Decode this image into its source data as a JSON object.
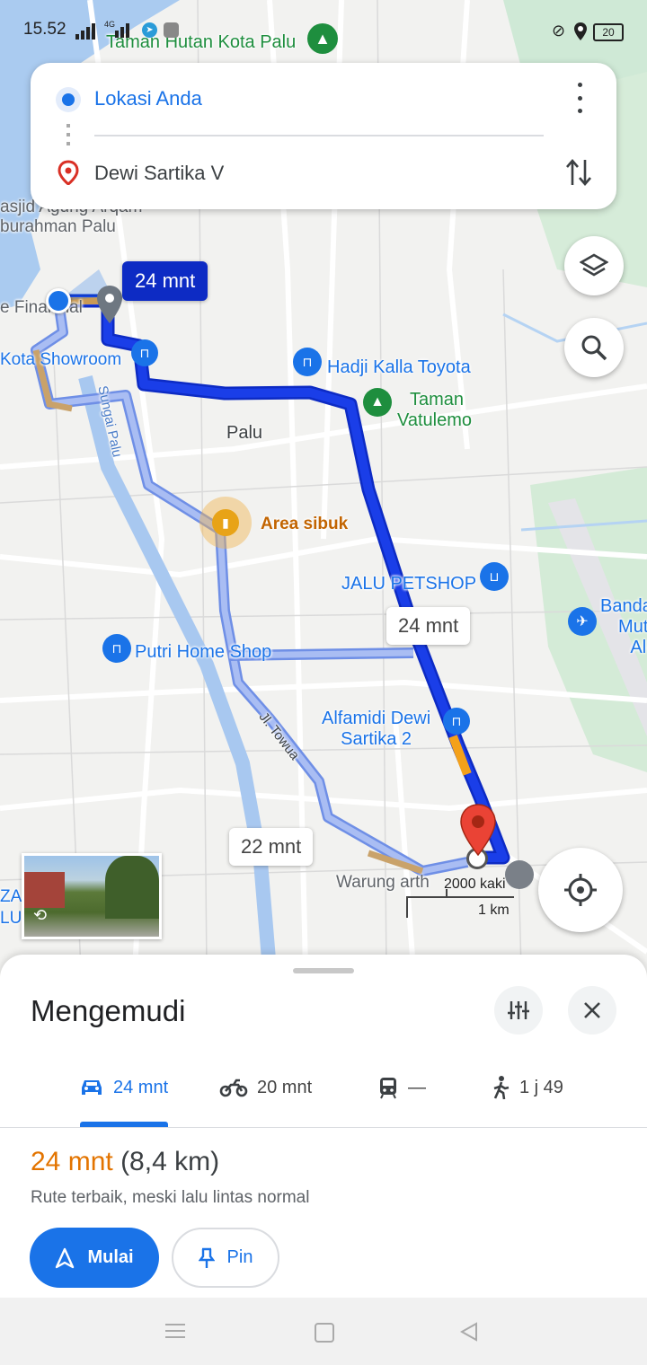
{
  "status_bar": {
    "time": "15.52",
    "network": "4G",
    "battery": "20"
  },
  "directions": {
    "origin": "Lokasi Anda",
    "destination": "Dewi Sartika V"
  },
  "map": {
    "labels": {
      "park_top": "Taman Hutan Kota Palu",
      "mosque_line1": "asjid Agung Arqam",
      "mosque_line2": "burahman Palu",
      "finance": "e Financial",
      "showroom": "Kota Showroom",
      "river": "Sungai Palu",
      "toyota": "Hadji Kalla Toyota",
      "vatulemo_line1": "Taman",
      "vatulemo_line2": "Vatulemo",
      "city": "Palu",
      "busy_area": "Area sibuk",
      "petshop": "JALU PETSHOP",
      "airport_line1": "Banda",
      "airport_line2": "Muti",
      "airport_line3": "Al-",
      "putri": "Putri Home Shop",
      "alfamidi_line1": "Alfamidi Dewi",
      "alfamidi_line2": "Sartika 2",
      "towua": "Jl. Towua",
      "warung": "Warung arth",
      "left_edge_1": "ZA",
      "left_edge_2": "LU"
    },
    "eta_bubbles": {
      "primary": "24 mnt",
      "alt_1": "24 mnt",
      "alt_2": "22 mnt"
    },
    "scale": {
      "imperial": "2000 kaki",
      "metric": "1 km"
    }
  },
  "sheet": {
    "title": "Mengemudi",
    "modes": [
      {
        "icon": "car-icon",
        "label": "24 mnt",
        "selected": true
      },
      {
        "icon": "motorcycle-icon",
        "label": "20 mnt",
        "selected": false
      },
      {
        "icon": "transit-icon",
        "label": "—",
        "selected": false
      },
      {
        "icon": "walk-icon",
        "label": "1 j 49",
        "selected": false
      }
    ],
    "summary": {
      "duration": "24 mnt",
      "distance": "(8,4 km)",
      "note": "Rute terbaik, meski lalu lintas normal"
    },
    "start_label": "Mulai",
    "pin_label": "Pin"
  },
  "colors": {
    "route_primary": "#1a3ee8",
    "route_alt": "#8ea6ef",
    "accent_blue": "#1a73e8",
    "traffic_orange": "#e37400",
    "pin_red": "#d93025"
  }
}
